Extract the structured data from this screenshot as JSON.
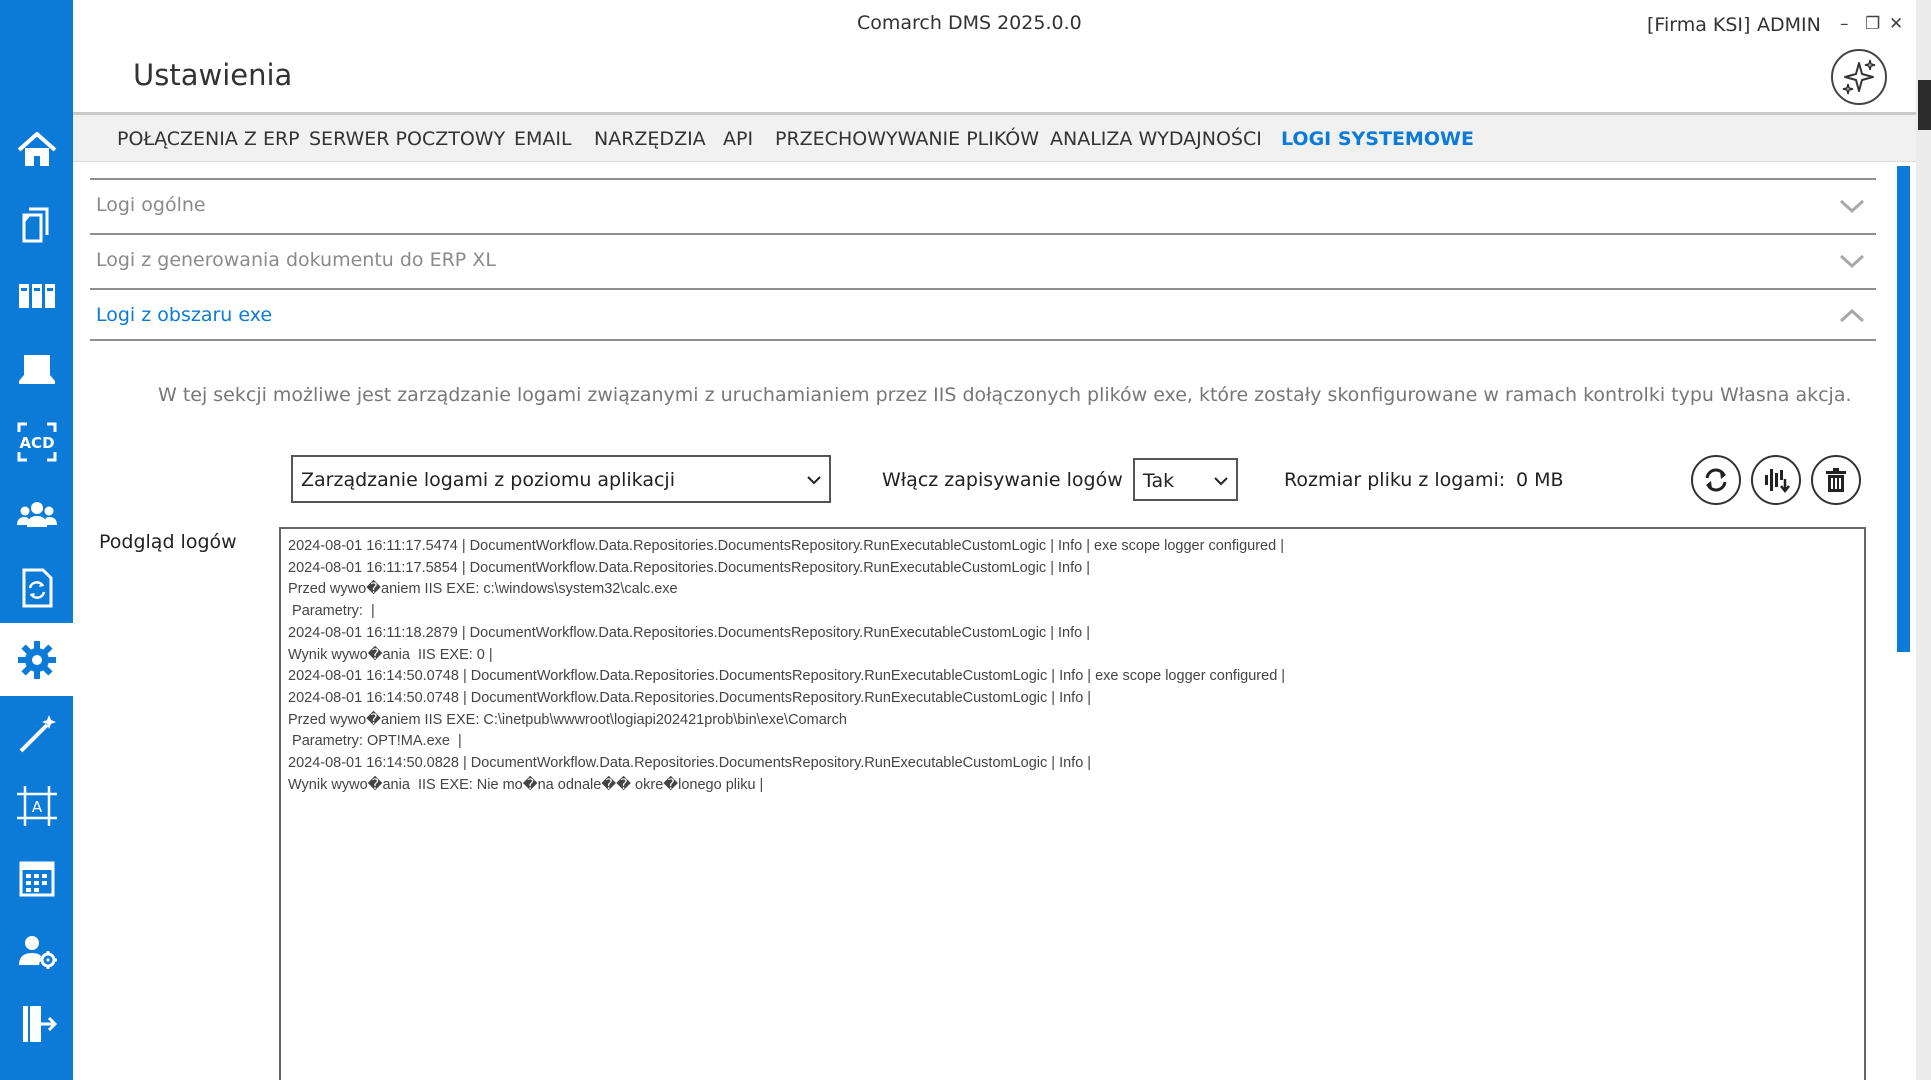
{
  "window": {
    "title": "Comarch DMS 2025.0.0",
    "company": "[Firma KSI]",
    "user": "ADMIN",
    "controls": [
      "–",
      "❐",
      "✕"
    ]
  },
  "page": {
    "title": "Ustawienia"
  },
  "sidebar": {
    "items": [
      {
        "icon": "home-icon",
        "active": false
      },
      {
        "icon": "documents-icon",
        "active": false
      },
      {
        "icon": "repository-icon",
        "active": false
      },
      {
        "icon": "workstation-icon",
        "active": false
      },
      {
        "icon": "acd-icon",
        "active": false
      },
      {
        "icon": "users-icon",
        "active": false
      },
      {
        "icon": "workflow-document-icon",
        "active": false
      },
      {
        "icon": "settings-gear-icon",
        "active": true
      },
      {
        "icon": "magic-wand-icon",
        "active": false
      },
      {
        "icon": "form-designer-icon",
        "active": false
      },
      {
        "icon": "calendar-icon",
        "active": false
      },
      {
        "icon": "user-settings-icon",
        "active": false
      },
      {
        "icon": "logout-icon",
        "active": false
      }
    ]
  },
  "tabs": [
    {
      "label": "POŁĄCZENIA Z ERP",
      "active": false
    },
    {
      "label": "SERWER POCZTOWY",
      "active": false
    },
    {
      "label": "EMAIL",
      "active": false
    },
    {
      "label": "NARZĘDZIA",
      "active": false
    },
    {
      "label": "API",
      "active": false
    },
    {
      "label": "PRZECHOWYWANIE PLIKÓW",
      "active": false
    },
    {
      "label": "ANALIZA WYDAJNOŚCI",
      "active": false
    },
    {
      "label": "LOGI SYSTEMOWE",
      "active": true
    }
  ],
  "accordion": [
    {
      "label": "Logi ogólne",
      "open": false
    },
    {
      "label": "Logi z generowania dokumentu do ERP XL",
      "open": false
    },
    {
      "label": "Logi z obszaru exe",
      "open": true
    }
  ],
  "section": {
    "description": "W tej sekcji możliwe jest zarządzanie logami związanymi z uruchamianiem przez IIS dołączonych plików exe, które zostały skonfigurowane w ramach kontrolki typu Własna akcja.",
    "mode_select": "Zarządzanie logami z poziomu aplikacji",
    "enable_label": "Włącz zapisywanie logów",
    "enable_value": "Tak",
    "size_label": "Rozmiar pliku z logami:",
    "size_value": "0 MB",
    "preview_label": "Podgląd logów"
  },
  "actions": [
    {
      "icon": "refresh-icon"
    },
    {
      "icon": "download-logs-icon"
    },
    {
      "icon": "trash-icon"
    }
  ],
  "logs": [
    "2024-08-01 16:11:17.5474 | DocumentWorkflow.Data.Repositories.DocumentsRepository.RunExecutableCustomLogic | Info | exe scope logger configured |",
    "2024-08-01 16:11:17.5854 | DocumentWorkflow.Data.Repositories.DocumentsRepository.RunExecutableCustomLogic | Info |",
    "Przed wywo�aniem IIS EXE: c:\\windows\\system32\\calc.exe",
    " Parametry:  |",
    "2024-08-01 16:11:18.2879 | DocumentWorkflow.Data.Repositories.DocumentsRepository.RunExecutableCustomLogic | Info |",
    "Wynik wywo�ania  IIS EXE: 0 |",
    "2024-08-01 16:14:50.0748 | DocumentWorkflow.Data.Repositories.DocumentsRepository.RunExecutableCustomLogic | Info | exe scope logger configured |",
    "2024-08-01 16:14:50.0748 | DocumentWorkflow.Data.Repositories.DocumentsRepository.RunExecutableCustomLogic | Info |",
    "Przed wywo�aniem IIS EXE: C:\\inetpub\\wwwroot\\logiapi202421prob\\bin\\exe\\Comarch",
    " Parametry: OPT!MA.exe  |",
    "2024-08-01 16:14:50.0828 | DocumentWorkflow.Data.Repositories.DocumentsRepository.RunExecutableCustomLogic | Info |",
    "Wynik wywo�ania  IIS EXE: Nie mo�na odnale�� okre�lonego pliku |"
  ],
  "colors": {
    "accent": "#0c7bd8",
    "sidebar": "#0c7bd8"
  }
}
